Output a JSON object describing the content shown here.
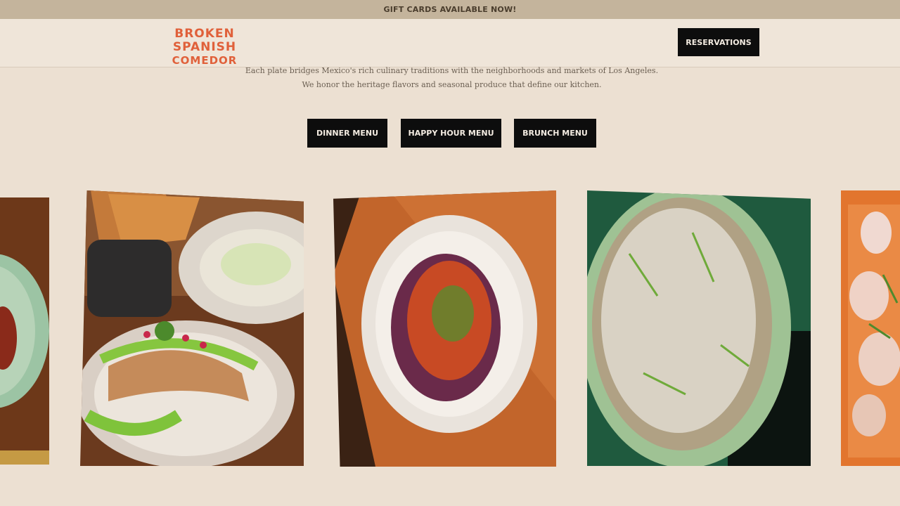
{
  "promo": {
    "text": "GIFT CARDS AVAILABLE NOW!"
  },
  "header": {
    "logo_line1": "BROKEN SPANISH",
    "logo_line2": "COMEDOR",
    "reservations_label": "RESERVATIONS"
  },
  "intro": {
    "line1": "Each plate bridges Mexico's rich culinary traditions with the neighborhoods and markets of Los Angeles.",
    "line2": "We honor the heritage flavors and seasonal produce that define our kitchen."
  },
  "menus": {
    "dinner": "DINNER MENU",
    "happy_hour": "HAPPY HOUR MENU",
    "brunch": "BRUNCH MENU"
  },
  "colors": {
    "brand": "#e0603a",
    "background": "#ece0d2",
    "promo_bar": "#c4b49c",
    "button": "#0d0d0d"
  },
  "gallery": {
    "photos": [
      {
        "name": "green-bowl-dish",
        "icon": "food-photo"
      },
      {
        "name": "enchilada-with-guacamole-sauce",
        "icon": "food-photo"
      },
      {
        "name": "mole-plate-on-board",
        "icon": "food-photo"
      },
      {
        "name": "shaved-grain-salad",
        "icon": "food-photo"
      },
      {
        "name": "ceviche-dish",
        "icon": "food-photo"
      }
    ]
  }
}
